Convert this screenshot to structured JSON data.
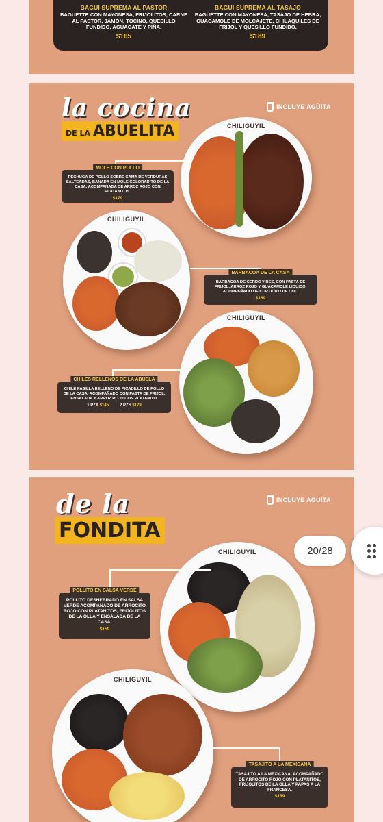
{
  "pages": {
    "top": {
      "left_title": "BAGUI SUPREMA AL PASTOR",
      "left_desc": "BAGUETTE CON MAYONESA, FRIJOLITOS, CARNE AL PASTOR, JAMÓN, TOCINO, QUESILLO FUNDIDO, AGUACATE Y PIÑA.",
      "left_price": "$165",
      "right_title": "BAGUI SUPREMA AL TASAJO",
      "right_desc": "BAGUETTE CON MAYONESA, TASAJO DE HEBRA, GUACAMOLE DE MOLCAJETE, CHILAQUILES DE FRIJOL Y QUESILLO FUNDIDO.",
      "right_price": "$189"
    },
    "abuelita": {
      "script_title": "la cocina",
      "band_small": "DE LA",
      "band_big": "ABUELITA",
      "incluye": "INCLUYE AGÜITA",
      "brand": "CHILIGUYIL",
      "dishes": [
        {
          "title": "MOLE CON POLLO",
          "desc": "PECHUGA DE POLLO SOBRE CAMA DE VERDURAS SALTEADAS, BANADA EN MOLE COLORADITO DE LA CASA, ACOMPANADA DE ARROZ ROJO CON PLATANITOS.",
          "price": "$179"
        },
        {
          "title": "BARBACOA DE LA CASA",
          "desc": "BARBACOA DE CERDO Y RES, CON PASTA DE FRIJOL, ARROZ ROJO Y GUACAMOLE LIQUIDO. ACOMPAÑADO DE CURTIDITO DE COL.",
          "price": "$189"
        },
        {
          "title": "CHILES RELLENOS DE LA ABUELA",
          "desc": "CHILE PASILLA RELLENO DE PICADILLO DE POLLO DE LA CASA, ACOMPAÑADO CON PASTA DE FRIJOL, ENSALADA Y ARROZ ROJO CON PLATANITO.",
          "opt1_label": "1 PZA",
          "opt1_price": "$145",
          "opt2_label": "2 PZS",
          "opt2_price": "$179"
        }
      ]
    },
    "fondita": {
      "script_title": "de la",
      "band_big": "FONDITA",
      "incluye": "INCLUYE AGÜITA",
      "brand": "CHILIGUYIL",
      "dishes": [
        {
          "title": "POLLITO EN SALSA VERDE",
          "desc": "POLLITO DESHEBRADO EN SALSA VERDE ACOMPAÑADO DE ARROCITO ROJO CON PLATANITOS, FRIJOLITOS DE LA OLLA Y ENSALADA DE LA CASA.",
          "price": "$159"
        },
        {
          "title": "TASAJITO A LA MEXICANA",
          "desc": "TASAJITO A LA MEXICANA, ACOMPAÑADO DE ARROCITO ROJO CON PLATANITOS, FRIJOLITOS DE LA OLLA Y PAPAS A LA FRANCESA.",
          "price": "$169"
        }
      ]
    }
  },
  "viewer": {
    "page_counter": "20/28"
  },
  "colors": {
    "background": "#e0a07e",
    "card": "#3a2f2b",
    "accent": "#f3b51f"
  }
}
